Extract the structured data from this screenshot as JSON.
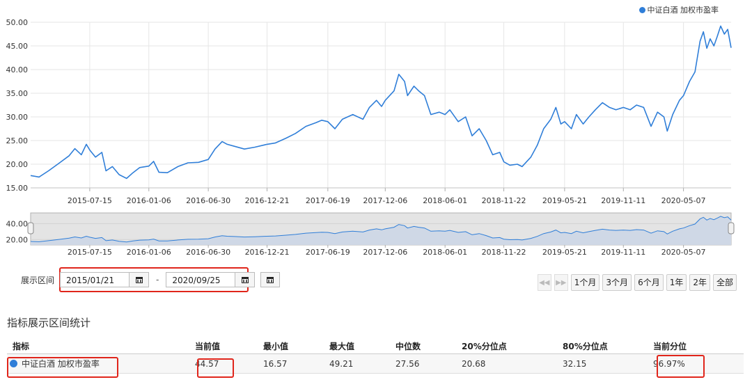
{
  "chart_data": {
    "type": "line",
    "series": [
      {
        "name": "中证白酒 加权市盈率"
      }
    ],
    "points": [
      [
        "2015-01-21",
        17.6
      ],
      [
        "2015-02-15",
        17.3
      ],
      [
        "2015-03-15",
        18.6
      ],
      [
        "2015-04-15",
        20.2
      ],
      [
        "2015-05-15",
        21.8
      ],
      [
        "2015-06-01",
        23.3
      ],
      [
        "2015-06-20",
        22.0
      ],
      [
        "2015-07-05",
        24.2
      ],
      [
        "2015-07-15",
        23.0
      ],
      [
        "2015-08-01",
        21.5
      ],
      [
        "2015-08-20",
        22.5
      ],
      [
        "2015-09-01",
        18.6
      ],
      [
        "2015-09-20",
        19.5
      ],
      [
        "2015-10-10",
        17.8
      ],
      [
        "2015-11-01",
        17.0
      ],
      [
        "2015-11-20",
        18.2
      ],
      [
        "2015-12-10",
        19.3
      ],
      [
        "2016-01-06",
        19.6
      ],
      [
        "2016-01-20",
        20.6
      ],
      [
        "2016-02-05",
        18.3
      ],
      [
        "2016-03-01",
        18.2
      ],
      [
        "2016-04-01",
        19.5
      ],
      [
        "2016-05-01",
        20.3
      ],
      [
        "2016-06-01",
        20.4
      ],
      [
        "2016-06-30",
        21.0
      ],
      [
        "2016-07-20",
        23.2
      ],
      [
        "2016-08-10",
        24.8
      ],
      [
        "2016-08-25",
        24.2
      ],
      [
        "2016-09-15",
        23.8
      ],
      [
        "2016-10-15",
        23.2
      ],
      [
        "2016-11-15",
        23.6
      ],
      [
        "2016-12-21",
        24.2
      ],
      [
        "2017-01-15",
        24.5
      ],
      [
        "2017-02-15",
        25.5
      ],
      [
        "2017-03-15",
        26.5
      ],
      [
        "2017-04-15",
        28.0
      ],
      [
        "2017-05-15",
        28.8
      ],
      [
        "2017-06-01",
        29.3
      ],
      [
        "2017-06-19",
        29.0
      ],
      [
        "2017-07-10",
        27.5
      ],
      [
        "2017-08-01",
        29.5
      ],
      [
        "2017-09-01",
        30.5
      ],
      [
        "2017-10-01",
        29.5
      ],
      [
        "2017-10-20",
        32.0
      ],
      [
        "2017-11-10",
        33.5
      ],
      [
        "2017-11-25",
        32.2
      ],
      [
        "2017-12-06",
        33.5
      ],
      [
        "2018-01-01",
        35.5
      ],
      [
        "2018-01-15",
        39.0
      ],
      [
        "2018-02-01",
        37.5
      ],
      [
        "2018-02-10",
        34.5
      ],
      [
        "2018-03-01",
        36.5
      ],
      [
        "2018-03-15",
        35.5
      ],
      [
        "2018-04-01",
        34.5
      ],
      [
        "2018-04-20",
        30.5
      ],
      [
        "2018-05-15",
        31.0
      ],
      [
        "2018-06-01",
        30.5
      ],
      [
        "2018-06-15",
        31.5
      ],
      [
        "2018-07-10",
        29.0
      ],
      [
        "2018-08-01",
        30.0
      ],
      [
        "2018-08-20",
        26.0
      ],
      [
        "2018-09-10",
        27.5
      ],
      [
        "2018-10-01",
        25.0
      ],
      [
        "2018-10-20",
        22.0
      ],
      [
        "2018-11-10",
        22.5
      ],
      [
        "2018-11-22",
        20.5
      ],
      [
        "2018-12-10",
        19.8
      ],
      [
        "2019-01-01",
        20.0
      ],
      [
        "2019-01-15",
        19.5
      ],
      [
        "2019-02-10",
        21.5
      ],
      [
        "2019-03-01",
        24.0
      ],
      [
        "2019-03-20",
        27.5
      ],
      [
        "2019-04-10",
        29.5
      ],
      [
        "2019-04-25",
        32.0
      ],
      [
        "2019-05-10",
        28.5
      ],
      [
        "2019-05-21",
        29.0
      ],
      [
        "2019-06-10",
        27.5
      ],
      [
        "2019-06-25",
        30.5
      ],
      [
        "2019-07-15",
        28.5
      ],
      [
        "2019-08-01",
        30.0
      ],
      [
        "2019-08-20",
        31.5
      ],
      [
        "2019-09-10",
        33.0
      ],
      [
        "2019-10-01",
        32.0
      ],
      [
        "2019-10-20",
        31.5
      ],
      [
        "2019-11-11",
        32.0
      ],
      [
        "2019-12-01",
        31.5
      ],
      [
        "2019-12-20",
        32.5
      ],
      [
        "2020-01-10",
        32.0
      ],
      [
        "2020-02-01",
        28.0
      ],
      [
        "2020-02-20",
        31.0
      ],
      [
        "2020-03-10",
        30.0
      ],
      [
        "2020-03-20",
        27.0
      ],
      [
        "2020-04-05",
        30.5
      ],
      [
        "2020-04-25",
        33.5
      ],
      [
        "2020-05-07",
        34.5
      ],
      [
        "2020-05-25",
        37.5
      ],
      [
        "2020-06-10",
        39.5
      ],
      [
        "2020-06-25",
        46.0
      ],
      [
        "2020-07-05",
        48.0
      ],
      [
        "2020-07-15",
        44.5
      ],
      [
        "2020-07-25",
        46.5
      ],
      [
        "2020-08-05",
        45.0
      ],
      [
        "2020-08-15",
        47.0
      ],
      [
        "2020-08-25",
        49.2
      ],
      [
        "2020-09-05",
        47.5
      ],
      [
        "2020-09-15",
        48.5
      ],
      [
        "2020-09-25",
        44.6
      ]
    ],
    "x_range": [
      "2015-01-21",
      "2020-09-25"
    ],
    "y_range": [
      15,
      50
    ],
    "y_ticks": [
      15,
      20,
      25,
      30,
      35,
      40,
      45,
      50
    ],
    "y_tick_labels": [
      "15.00",
      "20.00",
      "25.00",
      "30.00",
      "35.00",
      "40.00",
      "45.00",
      "50.00"
    ],
    "x_ticks": [
      "2015-07-15",
      "2016-01-06",
      "2016-06-30",
      "2016-12-21",
      "2017-06-19",
      "2017-12-06",
      "2018-06-01",
      "2018-11-22",
      "2019-05-21",
      "2019-11-11",
      "2020-05-07"
    ],
    "navigator_y_ticks": [
      20,
      40
    ],
    "navigator_y_tick_labels": [
      "20.00",
      "40.00"
    ],
    "grid": true,
    "legend": "top-right"
  },
  "legend_label": "中证白酒 加权市盈率",
  "range": {
    "label": "展示区间",
    "start": "2015/01/21",
    "end": "2020/09/25",
    "separator": "-"
  },
  "periods": [
    "1个月",
    "3个月",
    "6个月",
    "1年",
    "2年",
    "全部"
  ],
  "stats": {
    "title": "指标展示区间统计",
    "headers": [
      "指标",
      "当前值",
      "最小值",
      "最大值",
      "中位数",
      "20%分位点",
      "80%分位点",
      "当前分位"
    ],
    "row": {
      "name": "中证白酒 加权市盈率",
      "current": "44.57",
      "min": "16.57",
      "max": "49.21",
      "median": "27.56",
      "p20": "20.68",
      "p80": "32.15",
      "percentile": "96.97%"
    }
  },
  "colors": {
    "line": "#2f7ed8",
    "highlight": "#e0251b"
  }
}
